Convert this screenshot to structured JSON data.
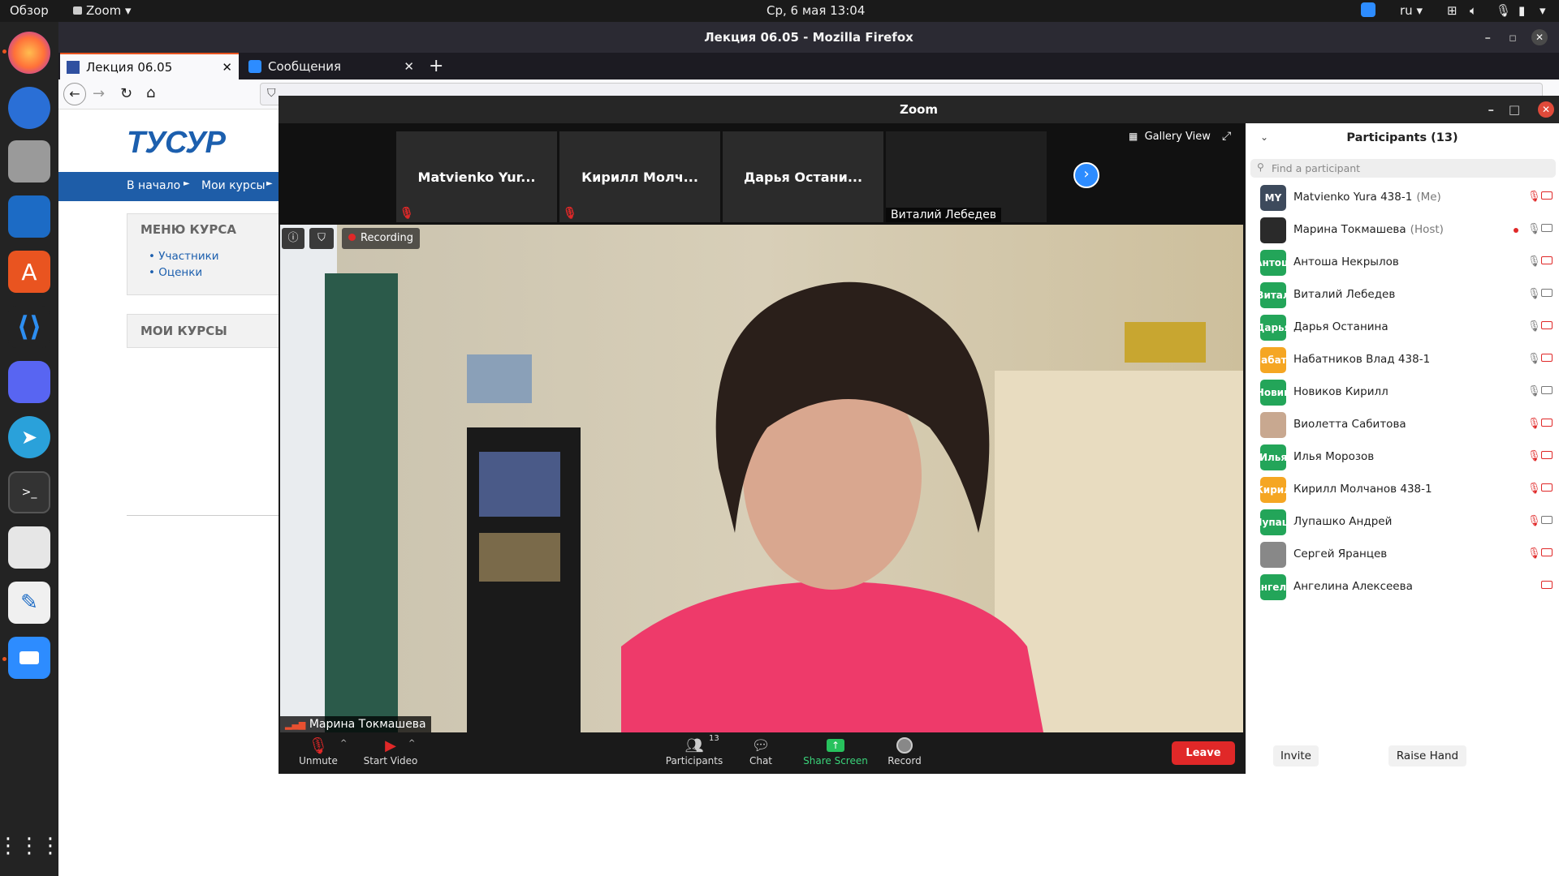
{
  "topbar": {
    "activities": "Обзор",
    "app": "Zoom",
    "clock": "Ср, 6 мая  13:04",
    "lang": "ru"
  },
  "firefox": {
    "window_title": "Лекция 06.05 - Mozilla Firefox",
    "tabs": [
      {
        "label": "Лекция 06.05"
      },
      {
        "label": "Сообщения"
      }
    ],
    "site": {
      "logo": "ТУСУР",
      "breadcrumb": [
        "В начало",
        "Мои курсы"
      ],
      "menu_title": "МЕНЮ КУРСА",
      "menu_items": [
        "Участники",
        "Оценки"
      ],
      "my_courses": "МОИ КУРСЫ"
    }
  },
  "zoom": {
    "window_title": "Zoom",
    "gallery_view": "Gallery View",
    "thumbnails": [
      {
        "name": "Matvienko Yur..."
      },
      {
        "name": "Кирилл Молч..."
      },
      {
        "name": "Дарья Остани..."
      },
      {
        "name": "Виталий Лебедев"
      }
    ],
    "recording": "Recording",
    "speaker_name": "Марина Токмашева",
    "controls": {
      "unmute": "Unmute",
      "start_video": "Start Video",
      "participants": "Participants",
      "participants_count": "13",
      "chat": "Chat",
      "share_screen": "Share Screen",
      "record": "Record",
      "leave": "Leave"
    },
    "panel": {
      "title": "Participants (13)",
      "search_placeholder": "Find a participant",
      "participants": [
        {
          "avatar": "MY",
          "name": "Matvienko Yura 438-1",
          "tag": "(Me)",
          "color": "#3d4a5c"
        },
        {
          "avatar": "",
          "name": "Марина Токмашева",
          "tag": "(Host)",
          "color": "#2a2a2a"
        },
        {
          "avatar": "Антош",
          "name": "Антоша Некрылов",
          "tag": "",
          "color": "#23a559"
        },
        {
          "avatar": "Витал",
          "name": "Виталий Лебедев",
          "tag": "",
          "color": "#23a559"
        },
        {
          "avatar": "Дарья",
          "name": "Дарья Останина",
          "tag": "",
          "color": "#23a559"
        },
        {
          "avatar": "Набатн",
          "name": "Набатников Влад 438-1",
          "tag": "",
          "color": "#f5a623"
        },
        {
          "avatar": "Новик",
          "name": "Новиков Кирилл",
          "tag": "",
          "color": "#23a559"
        },
        {
          "avatar": "",
          "name": "Виолетта Сабитова",
          "tag": "",
          "color": "#c8a890"
        },
        {
          "avatar": "Илья",
          "name": "Илья Морозов",
          "tag": "",
          "color": "#23a559"
        },
        {
          "avatar": "Кирил",
          "name": "Кирилл Молчанов 438-1",
          "tag": "",
          "color": "#f5a623"
        },
        {
          "avatar": "Лупаш",
          "name": "Лупашко Андрей",
          "tag": "",
          "color": "#23a559"
        },
        {
          "avatar": "",
          "name": "Сергей Яранцев",
          "tag": "",
          "color": "#888888"
        },
        {
          "avatar": "Ангели",
          "name": "Ангелина Алексеева",
          "tag": "",
          "color": "#23a559"
        }
      ],
      "invite": "Invite",
      "raise_hand": "Raise Hand"
    }
  }
}
